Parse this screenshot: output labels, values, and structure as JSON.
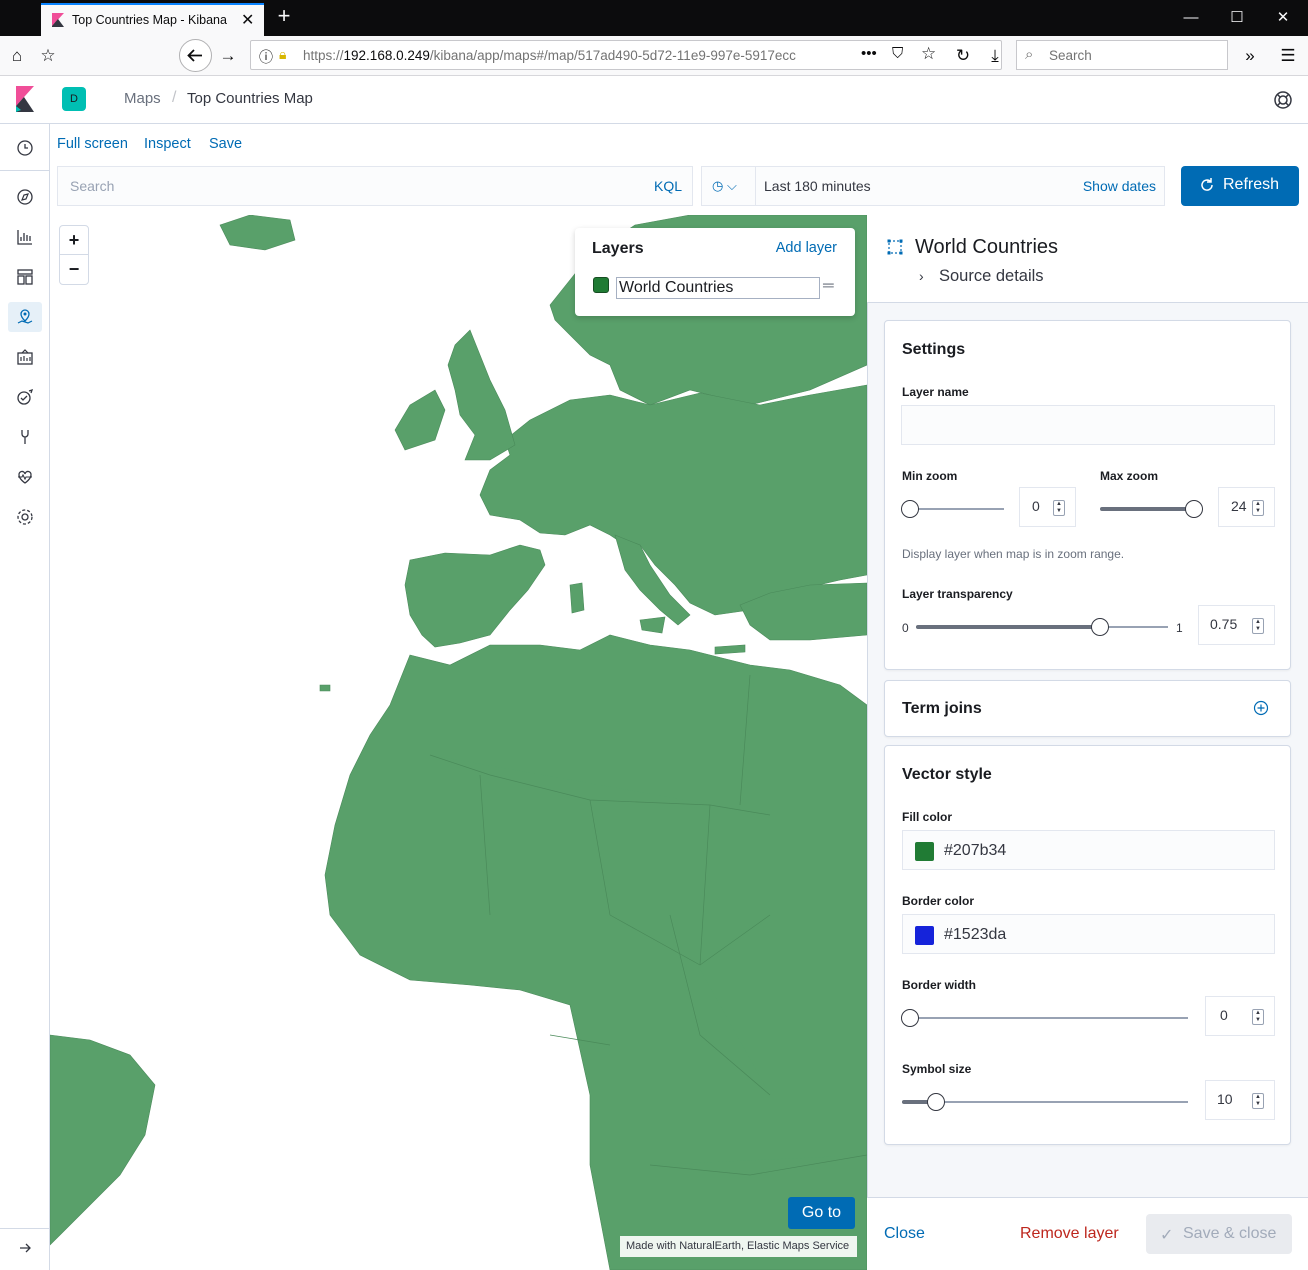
{
  "browser": {
    "tab_title": "Top Countries Map - Kibana",
    "url_prefix": "https://",
    "url_host": "192.168.0.249",
    "url_path": "/kibana/app/maps#/map/517ad490-5d72-11e9-997e-5917ecc",
    "search_placeholder": "Search"
  },
  "header": {
    "space_letter": "D",
    "breadcrumb_root": "Maps",
    "breadcrumb_current": "Top Countries Map"
  },
  "topnav": {
    "full_screen": "Full screen",
    "inspect": "Inspect",
    "save": "Save"
  },
  "query": {
    "search_placeholder": "Search",
    "language": "KQL",
    "time_range": "Last 180 minutes",
    "show_dates": "Show dates",
    "refresh": "Refresh"
  },
  "map": {
    "zoom_in": "+",
    "zoom_out": "−",
    "layers_title": "Layers",
    "add_layer": "Add layer",
    "layer_name": "World Countries",
    "goto": "Go to",
    "attribution": "Made with NaturalEarth, Elastic Maps Service",
    "land_color": "#59a06a"
  },
  "panel": {
    "title": "World Countries",
    "source_details": "Source details",
    "settings": {
      "title": "Settings",
      "layer_name_label": "Layer name",
      "layer_name_value": "",
      "min_zoom_label": "Min zoom",
      "min_zoom_value": "0",
      "max_zoom_label": "Max zoom",
      "max_zoom_value": "24",
      "zoom_help": "Display layer when map is in zoom range.",
      "transparency_label": "Layer transparency",
      "transparency_min": "0",
      "transparency_max": "1",
      "transparency_value": "0.75"
    },
    "term_joins": {
      "title": "Term joins"
    },
    "vector_style": {
      "title": "Vector style",
      "fill_label": "Fill color",
      "fill_value": "#207b34",
      "border_label": "Border color",
      "border_value": "#1523da",
      "border_width_label": "Border width",
      "border_width_value": "0",
      "symbol_size_label": "Symbol size",
      "symbol_size_value": "10"
    },
    "footer": {
      "close": "Close",
      "remove": "Remove layer",
      "save_close": "Save & close"
    }
  }
}
